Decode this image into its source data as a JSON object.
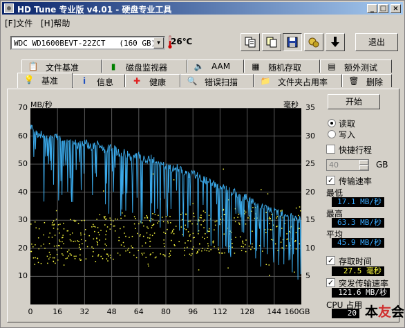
{
  "window": {
    "title": "HD Tune 专业版 v4.01 - 硬盘专业工具",
    "controls": [
      "_",
      "□",
      "×"
    ]
  },
  "menu": [
    {
      "label": "[F]文件"
    },
    {
      "label": "[H]帮助"
    }
  ],
  "toolbar": {
    "drive": "WDC WD1600BEVT-22ZCT   (160 GB)",
    "temperature": "26℃",
    "exit_label": "退出",
    "tools": [
      "copy-text-icon",
      "copy-screen-icon",
      "save-icon",
      "options-icon",
      "download-icon"
    ]
  },
  "tabs_row1": [
    {
      "label": "文件基准",
      "icon": "file-benchmark-icon"
    },
    {
      "label": "磁盘监视器",
      "icon": "disk-monitor-icon"
    },
    {
      "label": "AAM",
      "icon": "speaker-icon"
    },
    {
      "label": "随机存取",
      "icon": "random-access-icon"
    },
    {
      "label": "额外测试",
      "icon": "extra-tests-icon"
    }
  ],
  "tabs_row2": [
    {
      "label": "基准",
      "icon": "benchmark-icon",
      "active": true
    },
    {
      "label": "信息",
      "icon": "info-icon"
    },
    {
      "label": "健康",
      "icon": "health-icon"
    },
    {
      "label": "错误扫描",
      "icon": "error-scan-icon"
    },
    {
      "label": "文件夹占用率",
      "icon": "folder-icon"
    },
    {
      "label": "删除",
      "icon": "trash-icon"
    }
  ],
  "side": {
    "start_label": "开始",
    "read_label": "读取",
    "write_label": "写入",
    "short_stroke_label": "快捷行程",
    "short_stroke_value": "40",
    "short_stroke_unit": "GB",
    "transfer_rate_label": "传输速率",
    "min_label": "最低",
    "min_value": "17.1 MB/秒",
    "max_label": "最高",
    "max_value": "63.3 MB/秒",
    "avg_label": "平均",
    "avg_value": "45.9 MB/秒",
    "access_time_label": "存取时间",
    "access_time_value": "27.5 毫秒",
    "burst_label": "突发传输速率",
    "burst_value": "121.6 MB/秒",
    "cpu_label": "CPU 占用",
    "cpu_value": "20",
    "watermark": "本友会"
  },
  "chart_data": {
    "type": "line",
    "ylabel_left": "MB/秒",
    "ylabel_right": "毫秒",
    "y_left_ticks": [
      10,
      20,
      30,
      40,
      50,
      60,
      70
    ],
    "y_right_ticks": [
      5,
      10,
      15,
      20,
      25,
      30,
      35
    ],
    "x_ticks": [
      "0",
      "16",
      "32",
      "48",
      "64",
      "80",
      "96",
      "112",
      "128",
      "144",
      "160GB"
    ],
    "ylim": [
      0,
      70
    ],
    "y2lim": [
      0,
      35
    ],
    "xlim": [
      0,
      160
    ],
    "grid": true,
    "colors": {
      "transfer": "#3aa8e8",
      "access": "#ffff40",
      "grid": "#5a5a5a"
    },
    "series": [
      {
        "name": "传输速率",
        "x": [
          0,
          4,
          8,
          12,
          16,
          20,
          24,
          28,
          32,
          36,
          40,
          44,
          48,
          52,
          56,
          60,
          64,
          68,
          72,
          76,
          80,
          84,
          88,
          92,
          96,
          100,
          104,
          108,
          112,
          116,
          120,
          124,
          128,
          132,
          136,
          140,
          144,
          148,
          152,
          156,
          160
        ],
        "values": [
          63,
          61,
          60,
          59,
          60,
          58,
          59,
          57,
          58,
          56,
          57,
          55,
          56,
          54,
          54,
          52,
          53,
          51,
          52,
          50,
          49,
          48,
          49,
          46,
          47,
          45,
          44,
          43,
          42,
          41,
          40,
          38,
          38,
          36,
          35,
          34,
          33,
          33,
          32,
          31,
          30
        ]
      },
      {
        "name": "存取时间",
        "values": "scatter 10–22 ms"
      }
    ]
  }
}
